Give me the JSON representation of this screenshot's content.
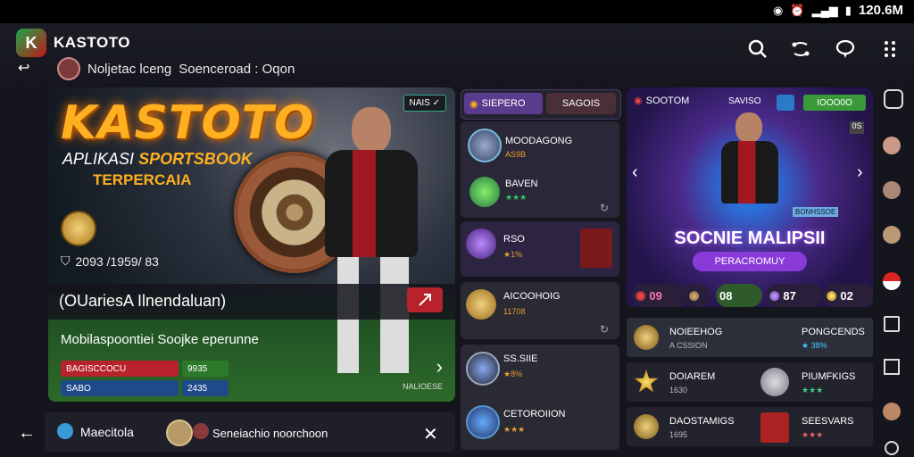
{
  "status": {
    "time": "120.6M"
  },
  "header": {
    "app_name": "KASTOTO",
    "breadcrumb": "Noljetac lceng",
    "breadcrumb_sep": "Soenceroad : Oqon"
  },
  "hero": {
    "brand": "KASTOTO",
    "tagline_prefix": "APLIKASI",
    "tagline_highlight": "SPORTSBOOK",
    "tagline_2": "TERPERCAIA",
    "badge": "NAIS ✓",
    "stats": "2093 /1959/ 83",
    "promo_title": "(OUariesA Ilnendaluan)",
    "subtitle": "Mobilaspoontiei Soojke eperunne",
    "chips": [
      "BAGISCCOCU",
      "9935",
      "SABO",
      "2435"
    ],
    "mini": "NALIOESE"
  },
  "bottombar": {
    "label": "Maecitola",
    "text": "Seneiachio noorchoon"
  },
  "middle": {
    "tabs": [
      "SIEPERO",
      "SAGOIS"
    ],
    "items": [
      {
        "title": "MOODAGONG",
        "sub": "AS9B"
      },
      {
        "title": "BAVEN",
        "sub": "★★★"
      },
      {
        "title": "RSO",
        "sub": "★1%"
      },
      {
        "title": "AICOOHOIG",
        "sub": "11708"
      },
      {
        "title": "SS.SIIE",
        "sub": "★8%"
      },
      {
        "title": "CETOROIION",
        "sub": "★★★"
      }
    ]
  },
  "right": {
    "card_tabs": [
      "SOOTOM",
      "SAVISO",
      "IOOO0O"
    ],
    "title": "SOCNIE MALIPSII",
    "button": "PERACROMUY",
    "counter": "0S",
    "card_sub": "BONHSSOE",
    "stats": [
      "09",
      "08",
      "87",
      "02"
    ],
    "rows": [
      {
        "title": "NOIEEHOG",
        "sub": "A CSSION",
        "right_title": "PONGCENDS",
        "right_sub": "★ 38%"
      },
      {
        "title": "DOIAREM",
        "sub": "1630",
        "right_title": "PIUMFKIGS",
        "right_sub": "★★★"
      },
      {
        "title": "DAOSTAMIGS",
        "sub": "1695",
        "right_title": "SEESVARS",
        "right_sub": "★★★"
      }
    ]
  },
  "colors": {
    "accent": "#ffb020",
    "red": "#b8222a",
    "purple": "#5a3c8e",
    "green": "#1aa84a"
  }
}
